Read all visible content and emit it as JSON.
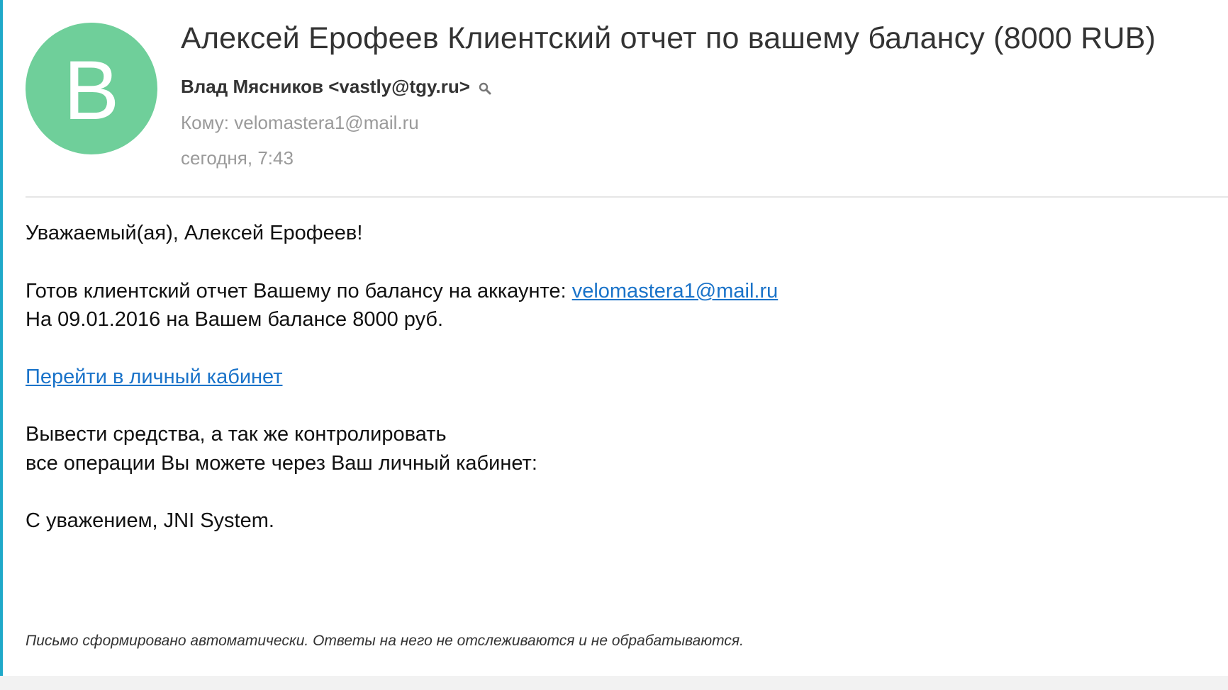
{
  "colors": {
    "avatar_bg": "#6fcf9a",
    "accent": "#1fa9c9",
    "link": "#1a73c9"
  },
  "header": {
    "avatar_letter": "В",
    "subject": "Алексей Ерофеев Клиентский отчет по вашему балансу (8000 RUB)",
    "sender": "Влад Мясников <vastly@tgy.ru>",
    "recipient_label": "Кому:",
    "recipient": "velomastera1@mail.ru",
    "date": "сегодня, 7:43"
  },
  "body": {
    "greeting": "Уважаемый(ая), Алексей Ерофеев!",
    "report_text": "Готов клиентский отчет Вашему по балансу на аккаунте: ",
    "account_link": "velomastera1@mail.ru",
    "balance_text": "На 09.01.2016 на Вашем балансе 8000 руб.",
    "cabinet_link": "Перейти в личный кабинет",
    "withdraw_line1": "Вывести средства, а так же контролировать",
    "withdraw_line2": "все операции Вы можете через Ваш личный кабинет:",
    "signature": "С уважением, JNI System.",
    "footnote": "Письмо сформировано автоматически. Ответы на него не отслеживаются и не обрабатываются."
  }
}
